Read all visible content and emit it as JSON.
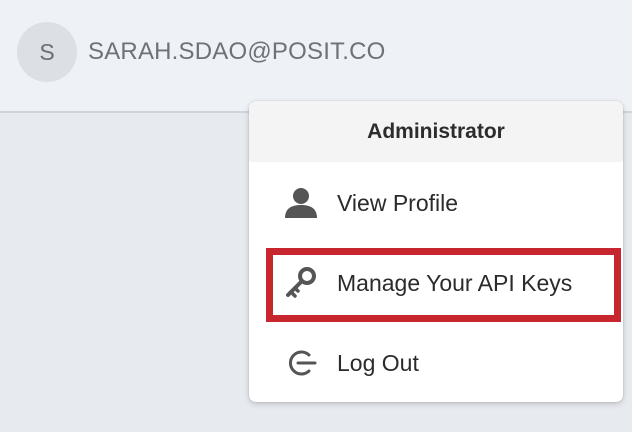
{
  "user": {
    "avatar_initial": "S",
    "email": "SARAH.SDAO@POSIT.CO"
  },
  "menu": {
    "header": "Administrator",
    "items": [
      {
        "label": "View Profile",
        "icon": "user-icon"
      },
      {
        "label": "Manage Your API Keys",
        "icon": "key-icon"
      },
      {
        "label": "Log Out",
        "icon": "logout-icon"
      }
    ]
  },
  "colors": {
    "highlight": "#c8262e",
    "icon": "#555555"
  }
}
